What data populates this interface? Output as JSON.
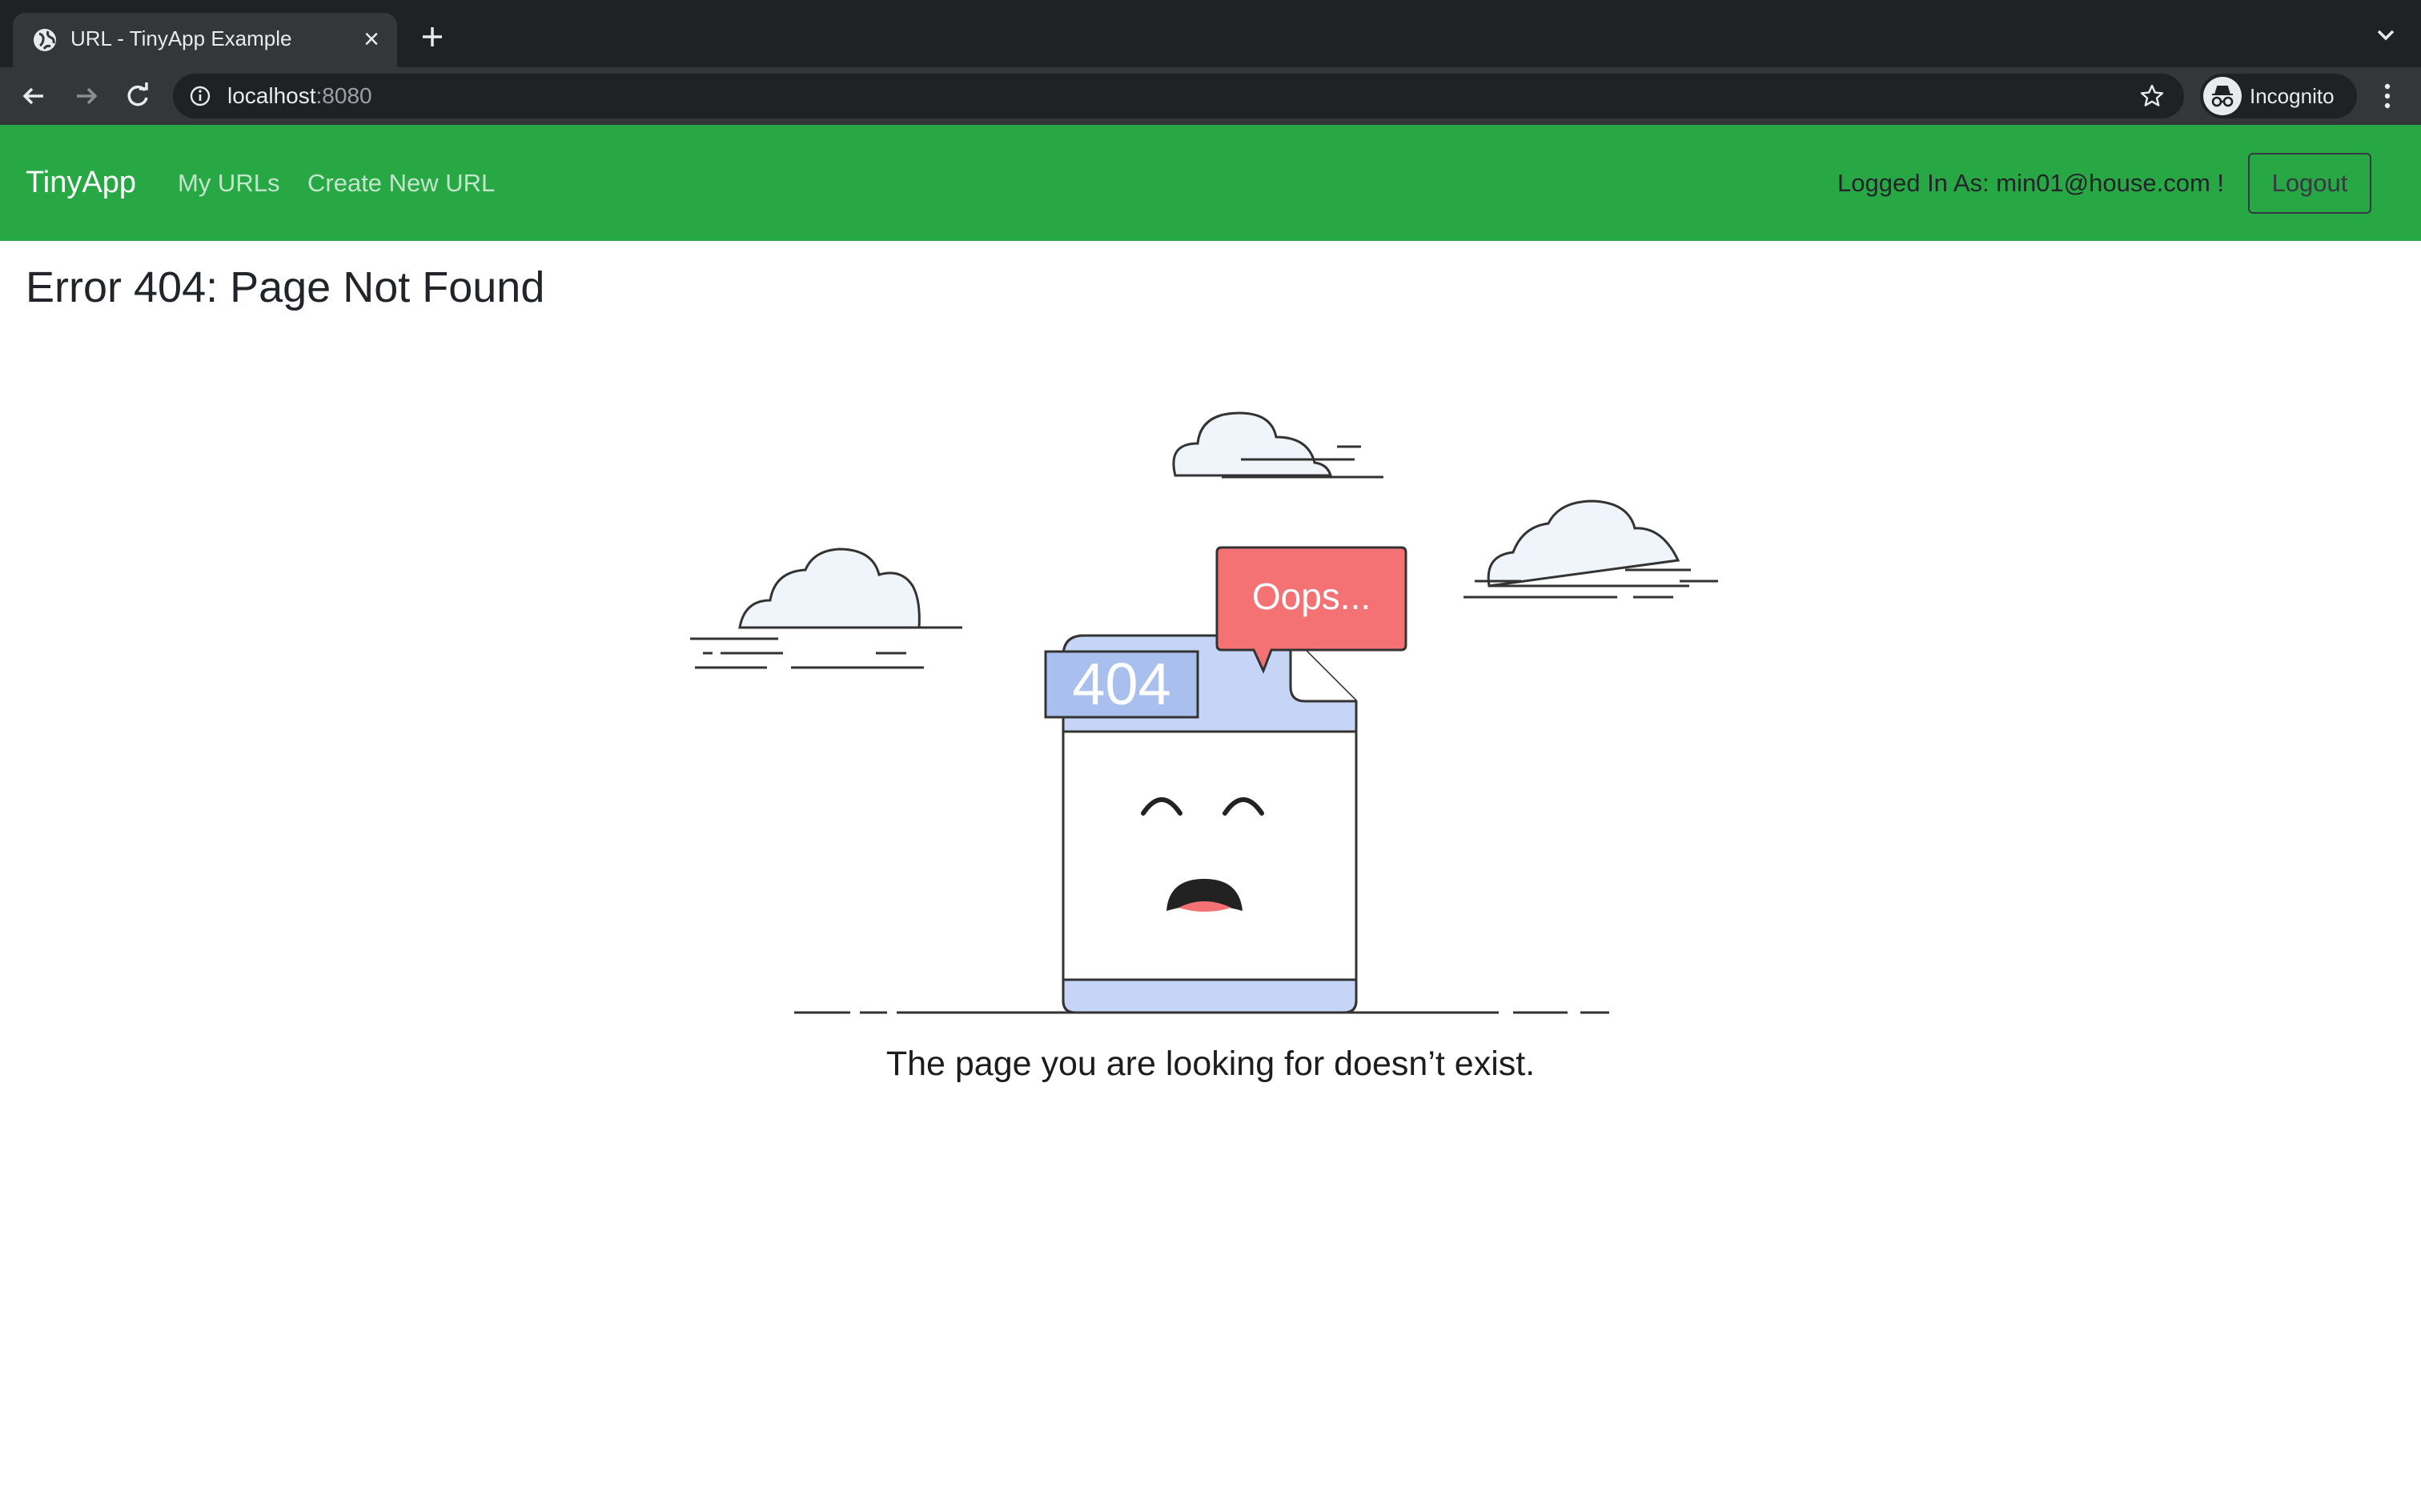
{
  "browser": {
    "tab_title": "URL - TinyApp Example",
    "url_host": "localhost",
    "url_port": ":8080",
    "profile_label": "Incognito"
  },
  "navbar": {
    "brand": "TinyApp",
    "links": [
      "My URLs",
      "Create New URL"
    ],
    "logged_in_text": "Logged In As: min01@house.com !",
    "logout_label": "Logout"
  },
  "main": {
    "title": "Error 404: Page Not Found",
    "illustration": {
      "code": "404",
      "bubble_text": "Oops..."
    },
    "caption": "The page you are looking for doesn’t exist."
  },
  "colors": {
    "navbar_bg": "#28a745",
    "bubble": "#f47174",
    "doc_accent": "#c6d4f5"
  }
}
